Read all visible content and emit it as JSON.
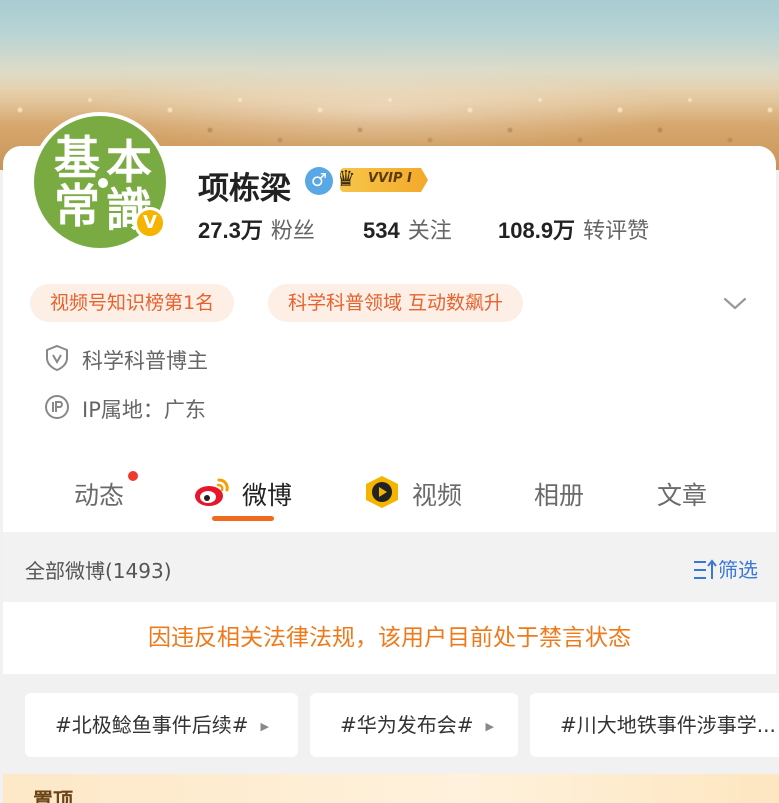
{
  "profile": {
    "name": "项栋梁",
    "gender_symbol": "♂",
    "vip_label": "VVIP I",
    "avatar_chars": [
      "基",
      "本",
      "常",
      "識"
    ],
    "verified_mark": "V"
  },
  "stats": [
    {
      "num": "27.3万",
      "label": "粉丝"
    },
    {
      "num": "534",
      "label": "关注"
    },
    {
      "num": "108.9万",
      "label": "转评赞"
    }
  ],
  "tags": [
    "视频号知识榜第1名",
    "科学科普领域 互动数飙升"
  ],
  "info": {
    "role": "科学科普博主",
    "ip": "IP属地：广东"
  },
  "tabs": [
    "动态",
    "微博",
    "视频",
    "相册",
    "文章"
  ],
  "feed": {
    "count_label": "全部微博(1493)",
    "filter_label": "筛选"
  },
  "notice": "因违反相关法律法规，该用户目前处于禁言状态",
  "trends": [
    "#北极鲶鱼事件后续#",
    "#华为发布会#",
    "#川大地铁事件涉事学..."
  ],
  "bottom": {
    "label": "置顶"
  },
  "colors": {
    "accent": "#f06a1f",
    "tag_bg": "#fdeee6",
    "tag_text": "#e8622e",
    "link_blue": "#3a78d6",
    "notice_text": "#ef7a1c"
  }
}
